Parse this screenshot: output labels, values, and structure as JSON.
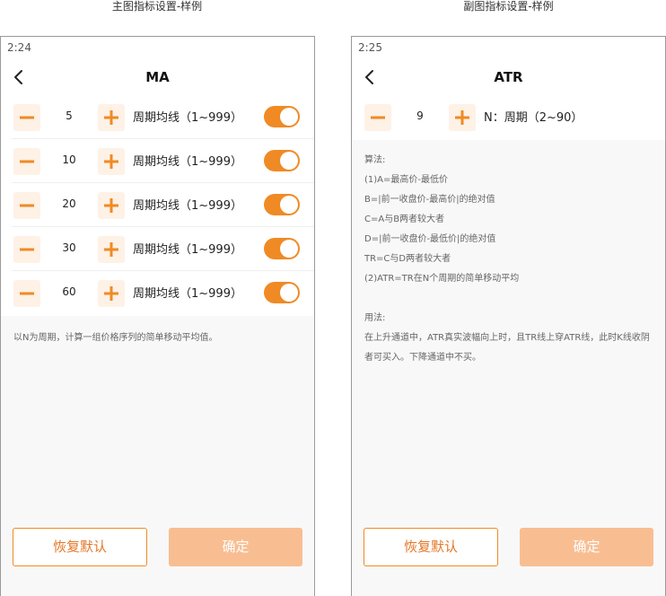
{
  "captions": {
    "left": "主图指标设置-样例",
    "right": "副图指标设置-样例"
  },
  "left_screen": {
    "status_time": "2:24",
    "title": "MA",
    "rows": [
      {
        "value": "5",
        "label": "周期均线（1~999）",
        "enabled": true
      },
      {
        "value": "10",
        "label": "周期均线（1~999）",
        "enabled": true
      },
      {
        "value": "20",
        "label": "周期均线（1~999）",
        "enabled": true
      },
      {
        "value": "30",
        "label": "周期均线（1~999）",
        "enabled": true
      },
      {
        "value": "60",
        "label": "周期均线（1~999）",
        "enabled": true
      }
    ],
    "description": "以N为周期，计算一组价格序列的简单移动平均值。",
    "reset_label": "恢复默认",
    "confirm_label": "确定"
  },
  "right_screen": {
    "status_time": "2:25",
    "title": "ATR",
    "row": {
      "value": "9",
      "label": "N：周期（2~90）"
    },
    "algorithm_heading": "算法:",
    "algorithm_lines": [
      "(1)A=最高价-最低价",
      "B=|前一收盘价-最高价|的绝对值",
      "C=A与B两者较大者",
      "D=|前一收盘价-最低价|的绝对值",
      "TR=C与D两者较大者",
      "(2)ATR=TR在N个周期的简单移动平均"
    ],
    "usage_heading": "用法:",
    "usage_text": "在上升通道中，ATR真实波幅向上时，且TR线上穿ATR线，此时K线收阴者可买入。下降通道中不买。",
    "reset_label": "恢复默认",
    "confirm_label": "确定"
  },
  "colors": {
    "accent": "#f08a24",
    "stepper_bg": "#fef1e6",
    "confirm_bg": "#f8be92",
    "page_bg": "#f8f8f8"
  },
  "icons": {
    "back": "chevron-left-icon",
    "minus": "minus-icon",
    "plus": "plus-icon"
  }
}
